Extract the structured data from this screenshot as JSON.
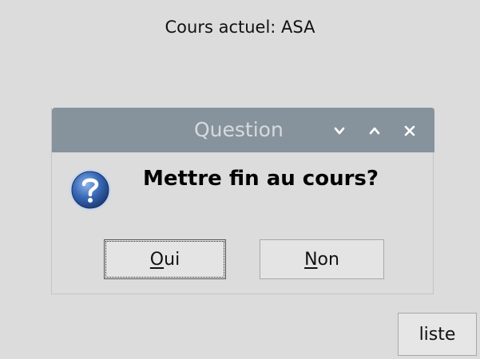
{
  "main": {
    "course_label": "Cours actuel: ASA",
    "liste_button": "liste"
  },
  "dialog": {
    "title": "Question",
    "message": "Mettre fin au cours?",
    "icon": "question-icon",
    "titlebar_buttons": [
      "minimize-icon",
      "maximize-icon",
      "close-icon"
    ],
    "buttons": [
      {
        "mnemonic": "O",
        "rest": "ui"
      },
      {
        "mnemonic": "N",
        "rest": "on"
      }
    ]
  },
  "colors": {
    "background": "#dcdcdc",
    "titlebar": "#87939c",
    "title_text": "#d6dadd",
    "icon_blue": "#3a6ab8"
  }
}
